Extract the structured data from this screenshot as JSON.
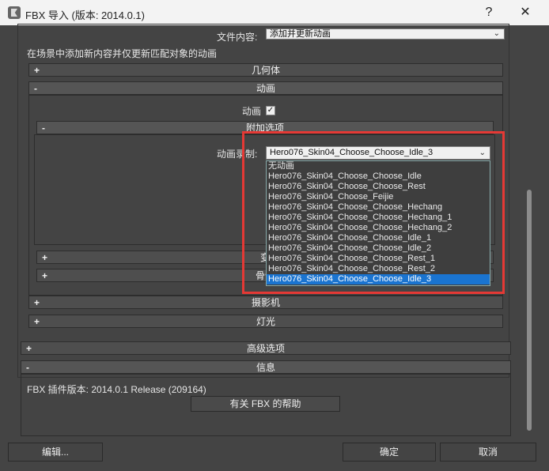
{
  "window": {
    "title": "FBX 导入 (版本: 2014.0.1)",
    "help_btn": "?",
    "close_btn": "✕"
  },
  "file_content": {
    "label": "文件内容:",
    "value": "添加并更新动画"
  },
  "description": "在场景中添加新内容并仅更新匹配对象的动画",
  "rollouts": {
    "geometry": "几何体",
    "animation": "动画",
    "extra_options": "附加选项",
    "transform": "变",
    "bones": "骨骼",
    "camera": "摄影机",
    "lights": "灯光",
    "advanced": "高级选项",
    "info": "信息"
  },
  "animation": {
    "checkbox_label": "动画",
    "checkbox_checked": true,
    "take_label": "动画录制:",
    "take_value": "Hero076_Skin04_Choose_Choose_Idle_3",
    "options": [
      "无动画",
      "Hero076_Skin04_Choose_Choose_Idle",
      "Hero076_Skin04_Choose_Choose_Rest",
      "Hero076_Skin04_Choose_Feijie",
      "Hero076_Skin04_Choose_Choose_Hechang",
      "Hero076_Skin04_Choose_Choose_Hechang_1",
      "Hero076_Skin04_Choose_Choose_Hechang_2",
      "Hero076_Skin04_Choose_Choose_Idle_1",
      "Hero076_Skin04_Choose_Choose_Idle_2",
      "Hero076_Skin04_Choose_Choose_Rest_1",
      "Hero076_Skin04_Choose_Choose_Rest_2",
      "Hero076_Skin04_Choose_Choose_Idle_3"
    ],
    "selected_index": 11
  },
  "info": {
    "plugin_version": "FBX 插件版本: 2014.0.1 Release (209164)",
    "help_button": "有关 FBX 的帮助"
  },
  "footer": {
    "edit": "编辑...",
    "ok": "确定",
    "cancel": "取消"
  },
  "colors": {
    "highlight": "#e53935",
    "selection": "#1a74d0"
  }
}
